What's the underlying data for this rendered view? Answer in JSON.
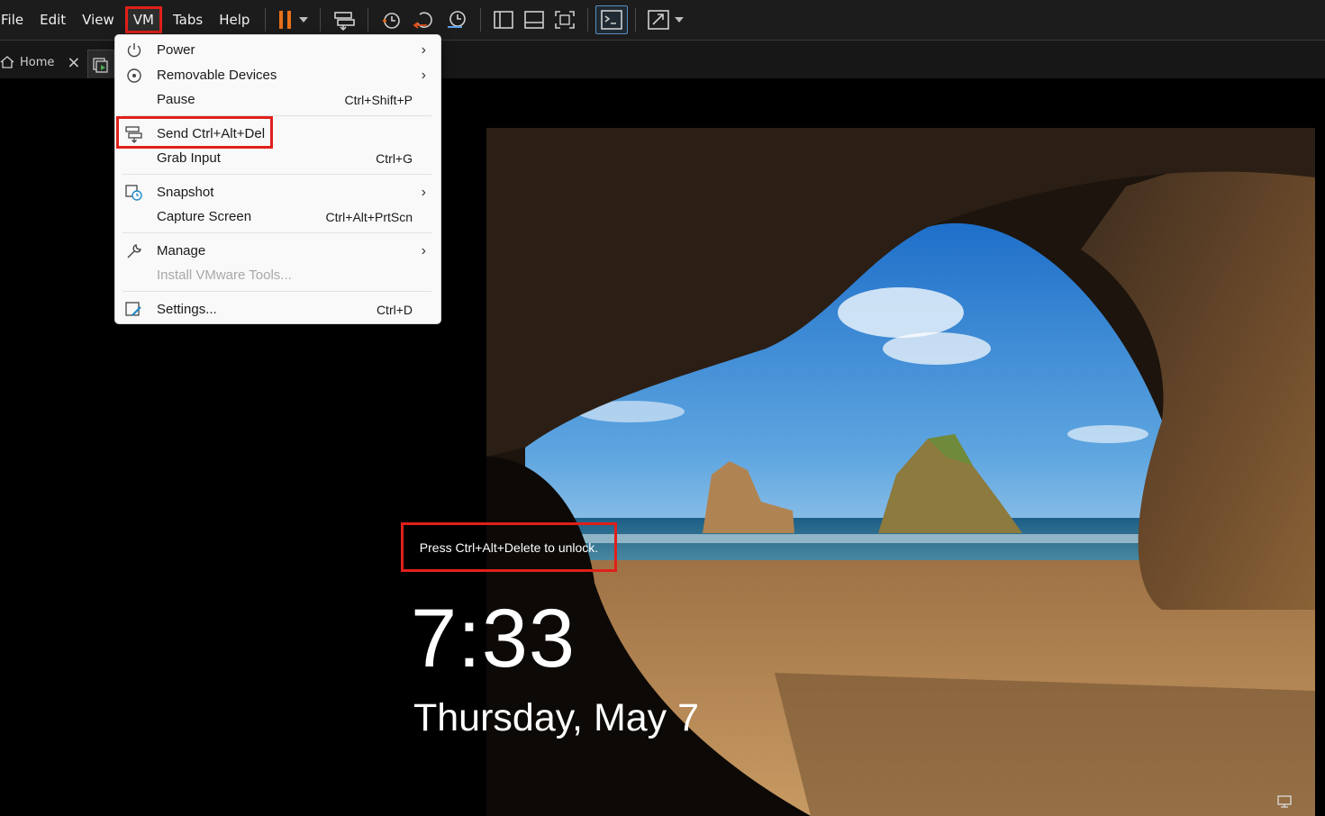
{
  "menubar": {
    "items": [
      "File",
      "Edit",
      "View",
      "VM",
      "Tabs",
      "Help"
    ],
    "active": "VM"
  },
  "colors": {
    "pause_orange": "#e8711a",
    "highlight_red": "#e0201a",
    "menu_bg": "#f9f9f9",
    "toolbar_bg": "#1c1c1c"
  },
  "toolbar": {
    "icons": [
      "pause-icon",
      "send-ctrl-alt-del-icon",
      "snapshot-icon",
      "revert-snapshot-icon",
      "snapshot-manager-icon",
      "sidebar-view-icon",
      "thumbnail-view-icon",
      "fit-guest-icon",
      "console-view-icon",
      "full-screen-icon"
    ]
  },
  "tabs": {
    "home_label": "Home"
  },
  "vm_menu": {
    "items": [
      {
        "label": "Power",
        "shortcut": "",
        "submenu": true,
        "icon": "power-icon"
      },
      {
        "label": "Removable Devices",
        "shortcut": "",
        "submenu": true,
        "icon": "removable-devices-icon"
      },
      {
        "label": "Pause",
        "shortcut": "Ctrl+Shift+P",
        "submenu": false,
        "icon": ""
      },
      {
        "label": "Send Ctrl+Alt+Del",
        "shortcut": "",
        "submenu": false,
        "icon": "send-ctrl-alt-del-icon",
        "highlighted": true
      },
      {
        "label": "Grab Input",
        "shortcut": "Ctrl+G",
        "submenu": false,
        "icon": ""
      },
      {
        "label": "Snapshot",
        "shortcut": "",
        "submenu": true,
        "icon": "snapshot-icon"
      },
      {
        "label": "Capture Screen",
        "shortcut": "Ctrl+Alt+PrtScn",
        "submenu": false,
        "icon": ""
      },
      {
        "label": "Manage",
        "shortcut": "",
        "submenu": true,
        "icon": "wrench-icon"
      },
      {
        "label": "Install VMware Tools...",
        "shortcut": "",
        "submenu": false,
        "icon": "",
        "disabled": true
      },
      {
        "label": "Settings...",
        "shortcut": "Ctrl+D",
        "submenu": false,
        "icon": "settings-icon"
      }
    ]
  },
  "lockscreen": {
    "prompt": "Press Ctrl+Alt+Delete to unlock.",
    "time": "7:33",
    "date": "Thursday, May 7"
  }
}
